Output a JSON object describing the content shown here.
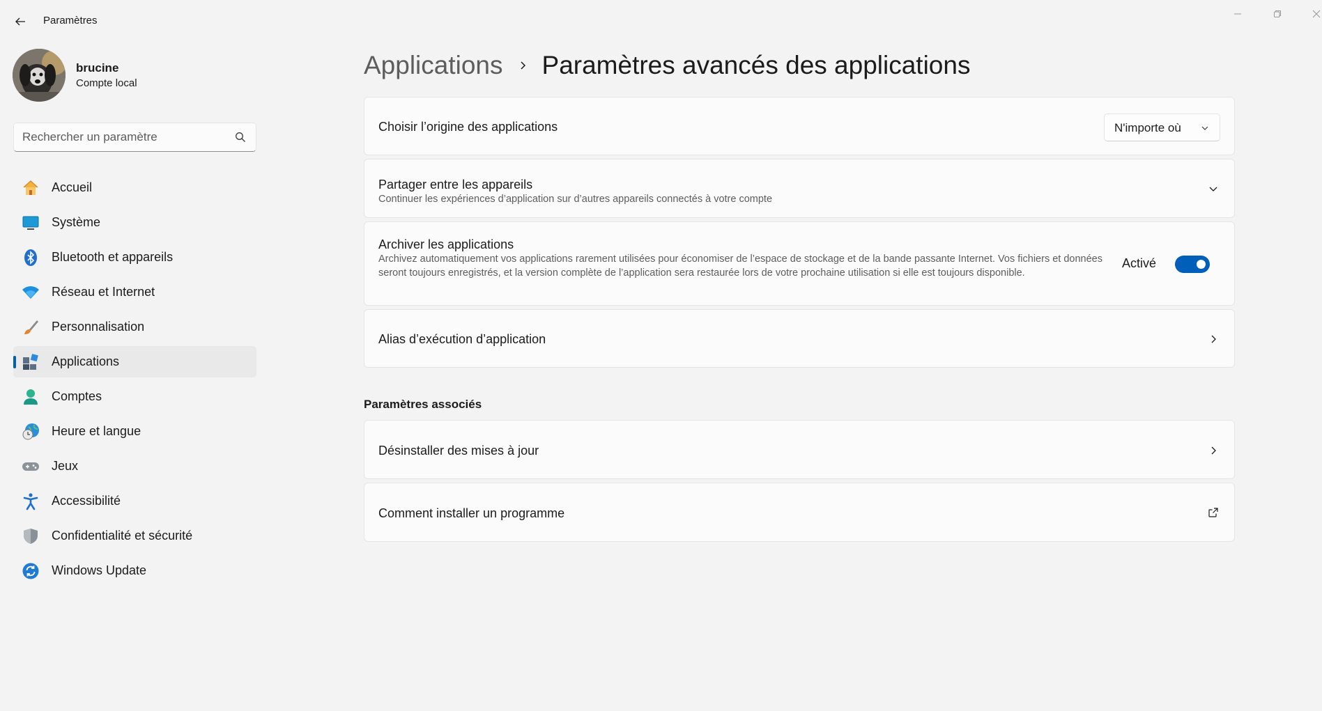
{
  "window": {
    "title": "Paramètres",
    "back_icon": "back-arrow-icon",
    "minimize_icon": "minimize-icon",
    "maximize_icon": "restore-icon",
    "close_icon": "close-icon"
  },
  "profile": {
    "name": "brucine",
    "account_type": "Compte local"
  },
  "search": {
    "placeholder": "Rechercher un paramètre",
    "value": ""
  },
  "sidebar": {
    "active_index": 5,
    "accent_color": "#005fb8",
    "items": [
      {
        "label": "Accueil",
        "icon": "home-icon"
      },
      {
        "label": "Système",
        "icon": "system-icon"
      },
      {
        "label": "Bluetooth et appareils",
        "icon": "bluetooth-icon"
      },
      {
        "label": "Réseau et Internet",
        "icon": "wifi-icon"
      },
      {
        "label": "Personnalisation",
        "icon": "brush-icon"
      },
      {
        "label": "Applications",
        "icon": "apps-icon"
      },
      {
        "label": "Comptes",
        "icon": "person-icon"
      },
      {
        "label": "Heure et langue",
        "icon": "clock-globe-icon"
      },
      {
        "label": "Jeux",
        "icon": "gamepad-icon"
      },
      {
        "label": "Accessibilité",
        "icon": "accessibility-icon"
      },
      {
        "label": "Confidentialité et sécurité",
        "icon": "shield-icon"
      },
      {
        "label": "Windows Update",
        "icon": "update-icon"
      }
    ]
  },
  "breadcrumb": {
    "parent": "Applications",
    "current": "Paramètres avancés des applications"
  },
  "settings": {
    "origin": {
      "title": "Choisir l’origine des applications",
      "dropdown_value": "N'importe où"
    },
    "share": {
      "title": "Partager entre les appareils",
      "description": "Continuer les expériences d’application sur d’autres appareils connectés à votre compte"
    },
    "archive": {
      "title": "Archiver les applications",
      "description": "Archivez automatiquement vos applications rarement utilisées pour économiser de l’espace de stockage et de la bande passante Internet. Vos fichiers et données seront toujours enregistrés, et la version complète de l’application sera restaurée lors de votre prochaine utilisation si elle est toujours disponible.",
      "toggle_label": "Activé",
      "toggle_on": true
    },
    "alias": {
      "title": "Alias d’exécution d’application"
    }
  },
  "related": {
    "section_title": "Paramètres associés",
    "items": [
      {
        "title": "Désinstaller des mises à jour",
        "icon": "chevron-right-icon"
      },
      {
        "title": "Comment installer un programme",
        "icon": "external-link-icon"
      }
    ]
  }
}
